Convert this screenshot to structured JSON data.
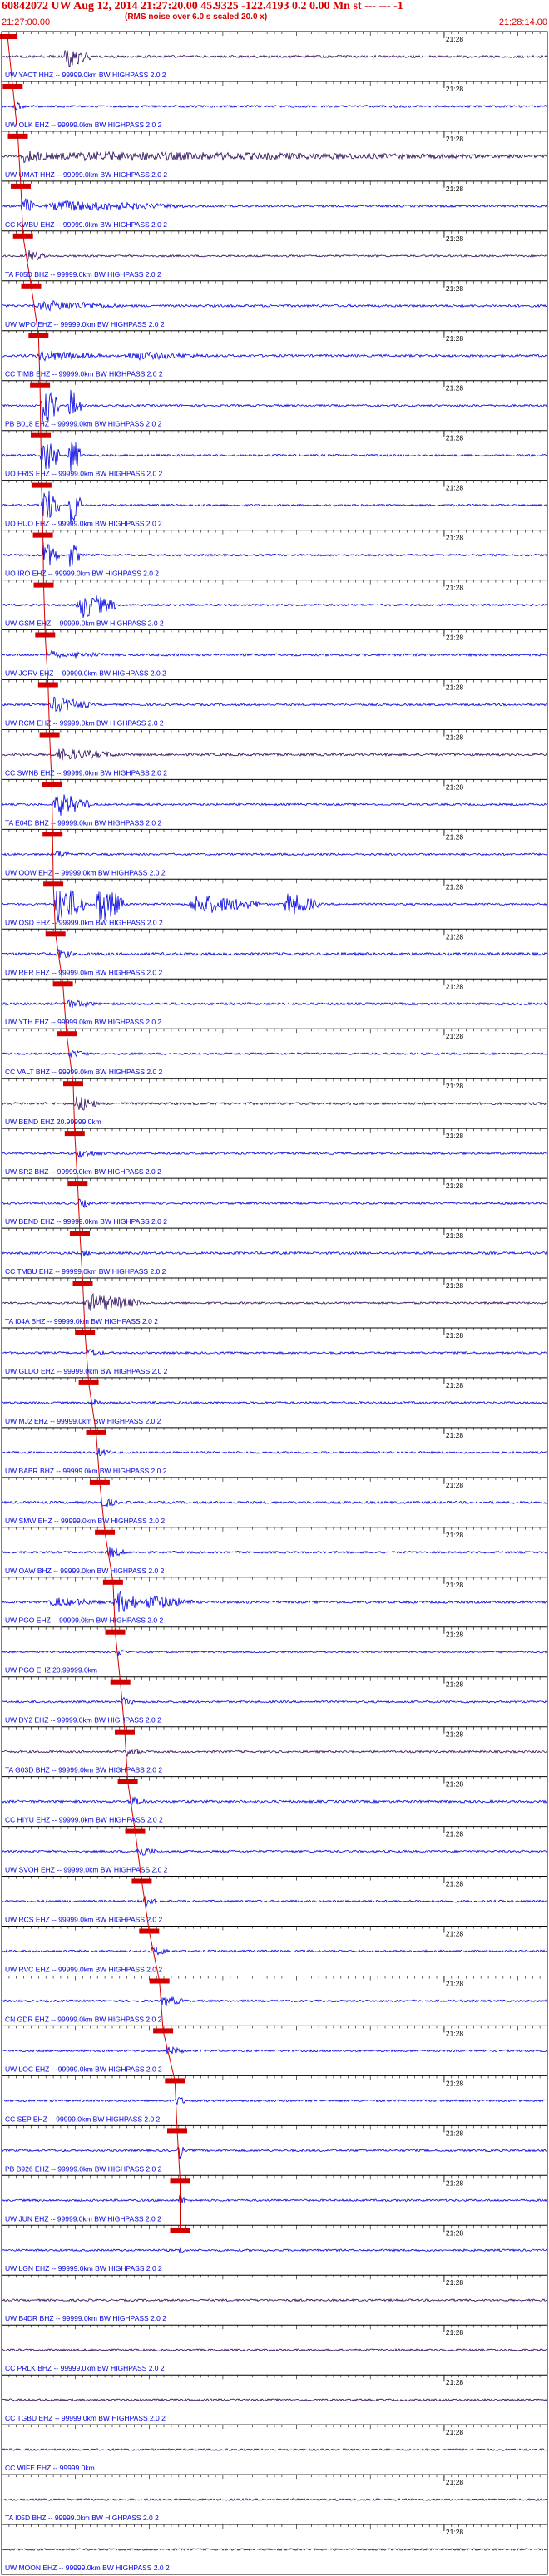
{
  "header": {
    "title": "60842072 UW Aug 12, 2014 21:27:20.00   45.9325 -122.4193  0.2 0.00 Mn st --- --- -1",
    "subtitle": "(RMS noise over 6.0 s scaled 20.0 x)",
    "start_time": "21:27:00.00",
    "end_time": "21:28:14.00"
  },
  "colors": {
    "red": "#d40000",
    "blue": "#0000e0",
    "purple": "#2a0a5a",
    "divider": "#000000",
    "tick": "#000000"
  },
  "chart_data": {
    "type": "line",
    "title": "60842072 UW Aug 12, 2014 21:27:20.00   45.9325 -122.4193  0.2 0.00 Mn st --- --- -1",
    "subtitle": "(RMS noise over 6.0 s scaled 20.0 x)",
    "x_start": "21:27:00.00",
    "x_end": "21:28:14.00",
    "xlim_seconds": [
      0,
      74
    ],
    "minute_marker_label": "21:28",
    "minute_marker_seconds": 60,
    "traces": [
      {
        "label": "UW YACT HHZ -- 99999.0km BW  HIGHPASS  2.0  2",
        "color": "purple",
        "pick_s": 0.8,
        "amp": 0.35,
        "bursts": [
          [
            8.2,
            12.2,
            3.2
          ]
        ]
      },
      {
        "label": "UW OLK EHZ -- 99999.0km BW  HIGHPASS  2.0  2",
        "color": "blue",
        "pick_s": 1.5,
        "amp": 0.3,
        "bursts": [
          [
            1.5,
            3.0,
            1.5
          ]
        ]
      },
      {
        "label": "UW UMAT HHZ -- 99999.0km BW  HIGHPASS  2.0  2",
        "color": "purple",
        "pick_s": 2.2,
        "amp": 0.3,
        "bursts": [
          [
            0,
            74,
            1.4
          ],
          [
            2.2,
            8,
            2.0
          ]
        ]
      },
      {
        "label": "CC KWBU EHZ -- 99999.0km BW  HIGHPASS  2.0  2",
        "color": "blue",
        "pick_s": 2.6,
        "amp": 0.3,
        "bursts": [
          [
            2.6,
            4.5,
            3.0
          ],
          [
            5,
            25,
            1.6
          ]
        ]
      },
      {
        "label": "TA F05D BHZ -- 99999.0km BW  HIGHPASS  2.0  2",
        "color": "purple",
        "pick_s": 2.9,
        "amp": 0.28,
        "bursts": [
          [
            3,
            6,
            2.0
          ]
        ]
      },
      {
        "label": "UW WPO EHZ -- 99999.0km BW  HIGHPASS  2.0  2",
        "color": "blue",
        "pick_s": 4.0,
        "amp": 0.35,
        "bursts": [
          [
            4,
            16,
            1.6
          ]
        ]
      },
      {
        "label": "CC TIMB EHZ -- 99999.0km BW  HIGHPASS  2.0  2",
        "color": "blue",
        "pick_s": 5.0,
        "amp": 0.35,
        "bursts": [
          [
            4,
            14,
            1.6
          ],
          [
            16,
            28,
            1.3
          ]
        ]
      },
      {
        "label": "PB B018 EHZ -- 99999.0km BW  HIGHPASS  2.0  2",
        "color": "blue",
        "pick_s": 5.2,
        "amp": 0.3,
        "bursts": [
          [
            5.2,
            7.8,
            6.0
          ],
          [
            9,
            10.8,
            5.0
          ]
        ]
      },
      {
        "label": "UO FRIS EHZ -- 99999.0km BW  HIGHPASS  2.0  2",
        "color": "blue",
        "pick_s": 5.3,
        "amp": 0.3,
        "bursts": [
          [
            5.2,
            7.8,
            6.0
          ],
          [
            9,
            10.8,
            6.0
          ]
        ]
      },
      {
        "label": "UO HUO EHZ -- 99999.0km BW  HIGHPASS  2.0  2",
        "color": "blue",
        "pick_s": 5.4,
        "amp": 0.3,
        "bursts": [
          [
            5.2,
            7.8,
            6.0
          ],
          [
            9,
            10.8,
            6.0
          ]
        ]
      },
      {
        "label": "UO IRO EHZ -- 99999.0km BW  HIGHPASS  2.0  2",
        "color": "blue",
        "pick_s": 5.6,
        "amp": 0.3,
        "bursts": [
          [
            5.2,
            7.8,
            4.5
          ],
          [
            9,
            10.8,
            4.0
          ]
        ]
      },
      {
        "label": "UW GSM EHZ -- 99999.0km BW  HIGHPASS  2.0  2",
        "color": "blue",
        "pick_s": 5.7,
        "amp": 0.3,
        "bursts": [
          [
            10,
            15.5,
            4.0
          ]
        ]
      },
      {
        "label": "UW JORV EHZ -- 99999.0km BW  HIGHPASS  2.0  2",
        "color": "blue",
        "pick_s": 5.9,
        "amp": 0.35,
        "bursts": [
          [
            6,
            9,
            1.3
          ],
          [
            9,
            15,
            1.0
          ]
        ]
      },
      {
        "label": "UW RCM EHZ -- 99999.0km BW  HIGHPASS  2.0  2",
        "color": "blue",
        "pick_s": 6.3,
        "amp": 0.3,
        "bursts": [
          [
            6.3,
            12,
            2.4
          ]
        ]
      },
      {
        "label": "CC SWNB EHZ -- 99999.0km BW  HIGHPASS  2.0  2",
        "color": "purple",
        "pick_s": 6.5,
        "amp": 0.35,
        "bursts": [
          [
            6.5,
            16,
            1.8
          ]
        ]
      },
      {
        "label": "TA E04D BHZ -- 99999.0km BW  HIGHPASS  2.0  2",
        "color": "blue",
        "pick_s": 6.8,
        "amp": 0.3,
        "bursts": [
          [
            6.8,
            12,
            3.5
          ]
        ]
      },
      {
        "label": "UW OOW EHZ -- 99999.0km BW  HIGHPASS  2.0  2",
        "color": "blue",
        "pick_s": 6.9,
        "amp": 0.3,
        "bursts": [
          [
            7,
            10,
            1.2
          ]
        ]
      },
      {
        "label": "UW OSD EHZ -- 99999.0km BW  HIGHPASS  2.0  2",
        "color": "blue",
        "pick_s": 7.0,
        "amp": 0.3,
        "bursts": [
          [
            7,
            11.5,
            6.0
          ],
          [
            12.5,
            16.5,
            6.0
          ],
          [
            25,
            35,
            3.0
          ],
          [
            38,
            43,
            3.5
          ]
        ]
      },
      {
        "label": "UW RER EHZ -- 99999.0km BW  HIGHPASS  2.0  2",
        "color": "blue",
        "pick_s": 7.3,
        "amp": 0.4,
        "bursts": [
          [
            7.3,
            10,
            1.5
          ]
        ]
      },
      {
        "label": "UW YTH EHZ -- 99999.0km BW  HIGHPASS  2.0  2",
        "color": "blue",
        "pick_s": 8.3,
        "amp": 0.35,
        "bursts": [
          [
            8,
            13,
            1.4
          ]
        ]
      },
      {
        "label": "CC VALT BHZ -- 99999.0km BW  HIGHPASS  2.0  2",
        "color": "blue",
        "pick_s": 8.8,
        "amp": 0.3,
        "bursts": [
          [
            8.8,
            12,
            1.3
          ]
        ]
      },
      {
        "label": "UW BEND EHZ 20.99999.0km",
        "color": "purple",
        "pick_s": 9.7,
        "amp": 0.35,
        "bursts": [
          [
            9.7,
            13,
            2.5
          ]
        ]
      },
      {
        "label": "UW SR2 BHZ -- 99999.0km BW  HIGHPASS  2.0  2",
        "color": "blue",
        "pick_s": 9.9,
        "amp": 0.3,
        "bursts": [
          [
            10,
            14,
            1.4
          ]
        ]
      },
      {
        "label": "UW BEND EHZ -- 99999.0km BW  HIGHPASS  2.0  2",
        "color": "blue",
        "pick_s": 10.3,
        "amp": 0.3,
        "bursts": [
          [
            10.3,
            12,
            1.6
          ]
        ]
      },
      {
        "label": "CC TMBU EHZ -- 99999.0km BW  HIGHPASS  2.0  2",
        "color": "blue",
        "pick_s": 10.6,
        "amp": 0.35,
        "bursts": [
          [
            10.6,
            12,
            1.5
          ]
        ]
      },
      {
        "label": "TA I04A BHZ -- 99999.0km BW  HIGHPASS  2.0  2",
        "color": "purple",
        "pick_s": 11.0,
        "amp": 0.3,
        "bursts": [
          [
            11,
            19,
            2.8
          ]
        ]
      },
      {
        "label": "UW GLDO EHZ -- 99999.0km BW  HIGHPASS  2.0  2",
        "color": "blue",
        "pick_s": 11.3,
        "amp": 0.3,
        "bursts": [
          [
            11.3,
            14,
            1.4
          ]
        ]
      },
      {
        "label": "UW MJ2 EHZ -- 99999.0km BW  HIGHPASS  2.0  2",
        "color": "blue",
        "pick_s": 11.8,
        "amp": 0.3,
        "bursts": [
          [
            11.8,
            14,
            1.3
          ]
        ]
      },
      {
        "label": "UW BABR BHZ -- 99999.0km BW  HIGHPASS  2.0  2",
        "color": "blue",
        "pick_s": 12.8,
        "amp": 0.3,
        "bursts": [
          [
            12.8,
            15,
            1.3
          ]
        ]
      },
      {
        "label": "UW SMW EHZ -- 99999.0km BW  HIGHPASS  2.0  2",
        "color": "blue",
        "pick_s": 13.3,
        "amp": 0.35,
        "bursts": [
          [
            13.3,
            16,
            1.5
          ]
        ]
      },
      {
        "label": "UW OAW BHZ -- 99999.0km BW  HIGHPASS  2.0  2",
        "color": "blue",
        "pick_s": 14.0,
        "amp": 0.3,
        "bursts": [
          [
            14,
            17,
            1.8
          ]
        ]
      },
      {
        "label": "UW PGO EHZ -- 99999.0km BW  HIGHPASS  2.0  2",
        "color": "blue",
        "pick_s": 15.1,
        "amp": 0.35,
        "bursts": [
          [
            6,
            14,
            1.4
          ],
          [
            15,
            19,
            3.5
          ],
          [
            19,
            26,
            2.2
          ]
        ]
      },
      {
        "label": "UW PGO EHZ 20.99999.0km",
        "color": "blue",
        "pick_s": 15.4,
        "amp": 0.25,
        "bursts": [
          [
            15.4,
            17,
            1.4
          ]
        ]
      },
      {
        "label": "UW DY2 EHZ -- 99999.0km BW  HIGHPASS  2.0  2",
        "color": "blue",
        "pick_s": 16.1,
        "amp": 0.3,
        "bursts": [
          [
            16,
            18,
            1.4
          ]
        ]
      },
      {
        "label": "TA G03D BHZ -- 99999.0km BW  HIGHPASS  2.0  2",
        "color": "purple",
        "pick_s": 16.7,
        "amp": 0.3,
        "bursts": [
          [
            16.7,
            19,
            1.6
          ]
        ]
      },
      {
        "label": "CC HIYU EHZ -- 99999.0km BW  HIGHPASS  2.0  2",
        "color": "blue",
        "pick_s": 17.1,
        "amp": 0.35,
        "bursts": [
          [
            17,
            20,
            1.5
          ]
        ]
      },
      {
        "label": "UW SVOH EHZ -- 99999.0km BW  HIGHPASS  2.0  2",
        "color": "blue",
        "pick_s": 18.1,
        "amp": 0.3,
        "bursts": [
          [
            18,
            21,
            1.8
          ]
        ]
      },
      {
        "label": "UW RCS EHZ -- 99999.0km BW  HIGHPASS  2.0  2",
        "color": "blue",
        "pick_s": 19.0,
        "amp": 0.3,
        "bursts": [
          [
            19,
            21,
            1.6
          ]
        ]
      },
      {
        "label": "UW RVC EHZ -- 99999.0km BW  HIGHPASS  2.0  2",
        "color": "blue",
        "pick_s": 20.0,
        "amp": 0.3,
        "bursts": [
          [
            20,
            23,
            1.5
          ]
        ]
      },
      {
        "label": "CN GDR EHZ -- 99999.0km BW  HIGHPASS  2.0  2",
        "color": "blue",
        "pick_s": 21.4,
        "amp": 0.3,
        "bursts": [
          [
            21.4,
            25,
            1.6
          ]
        ]
      },
      {
        "label": "UW LOC EHZ -- 99999.0km BW  HIGHPASS  2.0  2",
        "color": "blue",
        "pick_s": 21.9,
        "amp": 0.3,
        "bursts": [
          [
            22,
            25,
            1.4
          ]
        ]
      },
      {
        "label": "CC SEP EHZ -- 99999.0km BW  HIGHPASS  2.0  2",
        "color": "blue",
        "pick_s": 23.5,
        "amp": 0.3,
        "bursts": [
          [
            23.5,
            25,
            1.6
          ]
        ]
      },
      {
        "label": "PB B926 EHZ -- 99999.0km BW  HIGHPASS  2.0  2",
        "color": "blue",
        "pick_s": 23.8,
        "amp": 0.3,
        "bursts": [
          [
            23.8,
            24.8,
            3.0
          ]
        ]
      },
      {
        "label": "UW JUN EHZ -- 99999.0km BW  HIGHPASS  2.0  2",
        "color": "blue",
        "pick_s": 24.2,
        "amp": 0.3,
        "bursts": [
          [
            24,
            25,
            2.0
          ]
        ]
      },
      {
        "label": "UW LGN EHZ -- 99999.0km BW  HIGHPASS  2.0  2",
        "color": "blue",
        "pick_s": 24.2,
        "amp": 0.3,
        "bursts": [
          [
            24,
            25,
            1.6
          ]
        ]
      },
      {
        "label": "UW B4DR BHZ -- 99999.0km BW  HIGHPASS  2.0  2",
        "color": "purple",
        "pick_s": null,
        "amp": 0.3,
        "bursts": []
      },
      {
        "label": "CC PRLK BHZ -- 99999.0km BW  HIGHPASS  2.0  2",
        "color": "purple",
        "pick_s": null,
        "amp": 0.28,
        "bursts": []
      },
      {
        "label": "CC TGBU EHZ -- 99999.0km BW  HIGHPASS  2.0  2",
        "color": "purple",
        "pick_s": null,
        "amp": 0.28,
        "bursts": []
      },
      {
        "label": "CC WIFE EHZ -- 99999.0km",
        "color": "purple",
        "pick_s": null,
        "amp": 0.28,
        "bursts": []
      },
      {
        "label": "TA I05D BHZ -- 99999.0km BW  HIGHPASS  2.0  2",
        "color": "purple",
        "pick_s": null,
        "amp": 0.28,
        "bursts": []
      },
      {
        "label": "UW MOON EHZ -- 99999.0km BW  HIGHPASS  2.0  2",
        "color": "purple",
        "pick_s": null,
        "amp": 0.28,
        "bursts": []
      }
    ]
  }
}
